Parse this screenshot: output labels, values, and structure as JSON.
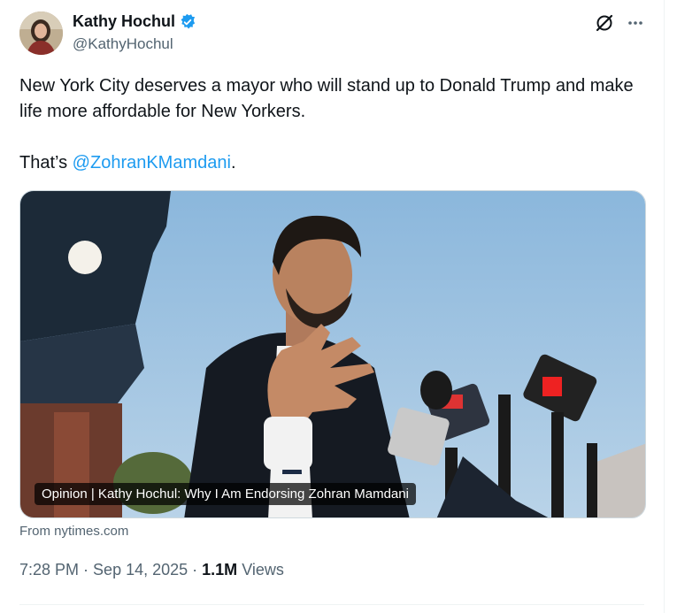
{
  "author": {
    "display_name": "Kathy Hochul",
    "handle": "@KathyHochul",
    "verified": true,
    "verified_color": "#1d9bf0"
  },
  "tweet": {
    "line1": "New York City deserves a mayor who will stand up to Donald Trump and make life more affordable for New Yorkers.",
    "line2_prefix": "That’s ",
    "mention": "@ZohranKMamdani",
    "line2_suffix": "."
  },
  "card": {
    "caption": "Opinion | Kathy Hochul: Why I Am Endorsing Zohran Mamdani",
    "source": "From nytimes.com"
  },
  "meta": {
    "time": "7:28 PM",
    "separator": " · ",
    "date": "Sep 14, 2025",
    "separator2": " · ",
    "views_count": "1.1M",
    "views_label": " Views"
  },
  "icons": {
    "grok": "grok-icon",
    "more": "more-icon",
    "verified": "verified-badge-icon"
  },
  "colors": {
    "text": "#0f1419",
    "secondary": "#536471",
    "link": "#1d9bf0"
  }
}
